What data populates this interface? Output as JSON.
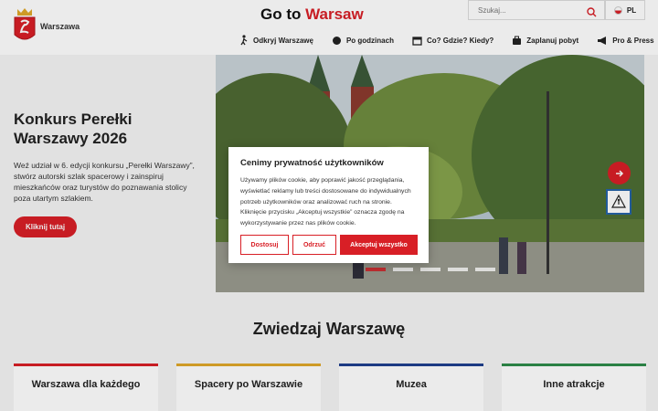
{
  "header": {
    "logo_text": "Warszawa",
    "title_prefix": "Go to ",
    "title_accent": "Warsaw",
    "search_placeholder": "Szukaj...",
    "language": "PL",
    "nav": [
      {
        "label": "Odkryj Warszawę",
        "icon": "person-walk-icon"
      },
      {
        "label": "Po godzinach",
        "icon": "disco-ball-icon"
      },
      {
        "label": "Co? Gdzie? Kiedy?",
        "icon": "calendar-icon"
      },
      {
        "label": "Zaplanuj pobyt",
        "icon": "suitcase-icon"
      },
      {
        "label": "Pro & Press",
        "icon": "megaphone-icon"
      }
    ]
  },
  "hero": {
    "title": "Konkurs Perełki Warszawy 2026",
    "description": "Weź udział w 6. edycji konkursu „Perełki Warszawy”, stwórz autorski szlak spacerowy i zainspiruj mieszkańców oraz turystów do poznawania stolicy poza utartym szlakiem.",
    "button": "Kliknij tutaj"
  },
  "section": {
    "title": "Zwiedzaj Warszawę",
    "cards": [
      {
        "label": "Warszawa dla każdego",
        "color": "#d81f26"
      },
      {
        "label": "Spacery po Warszawie",
        "color": "#e0a82a"
      },
      {
        "label": "Muzea",
        "color": "#1f3f8f"
      },
      {
        "label": "Inne atrakcje",
        "color": "#2e8b4a"
      }
    ]
  },
  "cookie": {
    "title": "Cenimy prywatność użytkowników",
    "text": "Używamy plików cookie, aby poprawić jakość przeglądania, wyświetlać reklamy lub treści dostosowane do indywidualnych potrzeb użytkowników oraz analizować ruch na stronie. Kliknięcie przycisku „Akceptuj wszystkie” oznacza zgodę na wykorzystywanie przez nas plików cookie.",
    "customize": "Dostosuj",
    "reject": "Odrzuć",
    "accept": "Akceptuj wszystko"
  },
  "colors": {
    "accent": "#d81f26"
  }
}
